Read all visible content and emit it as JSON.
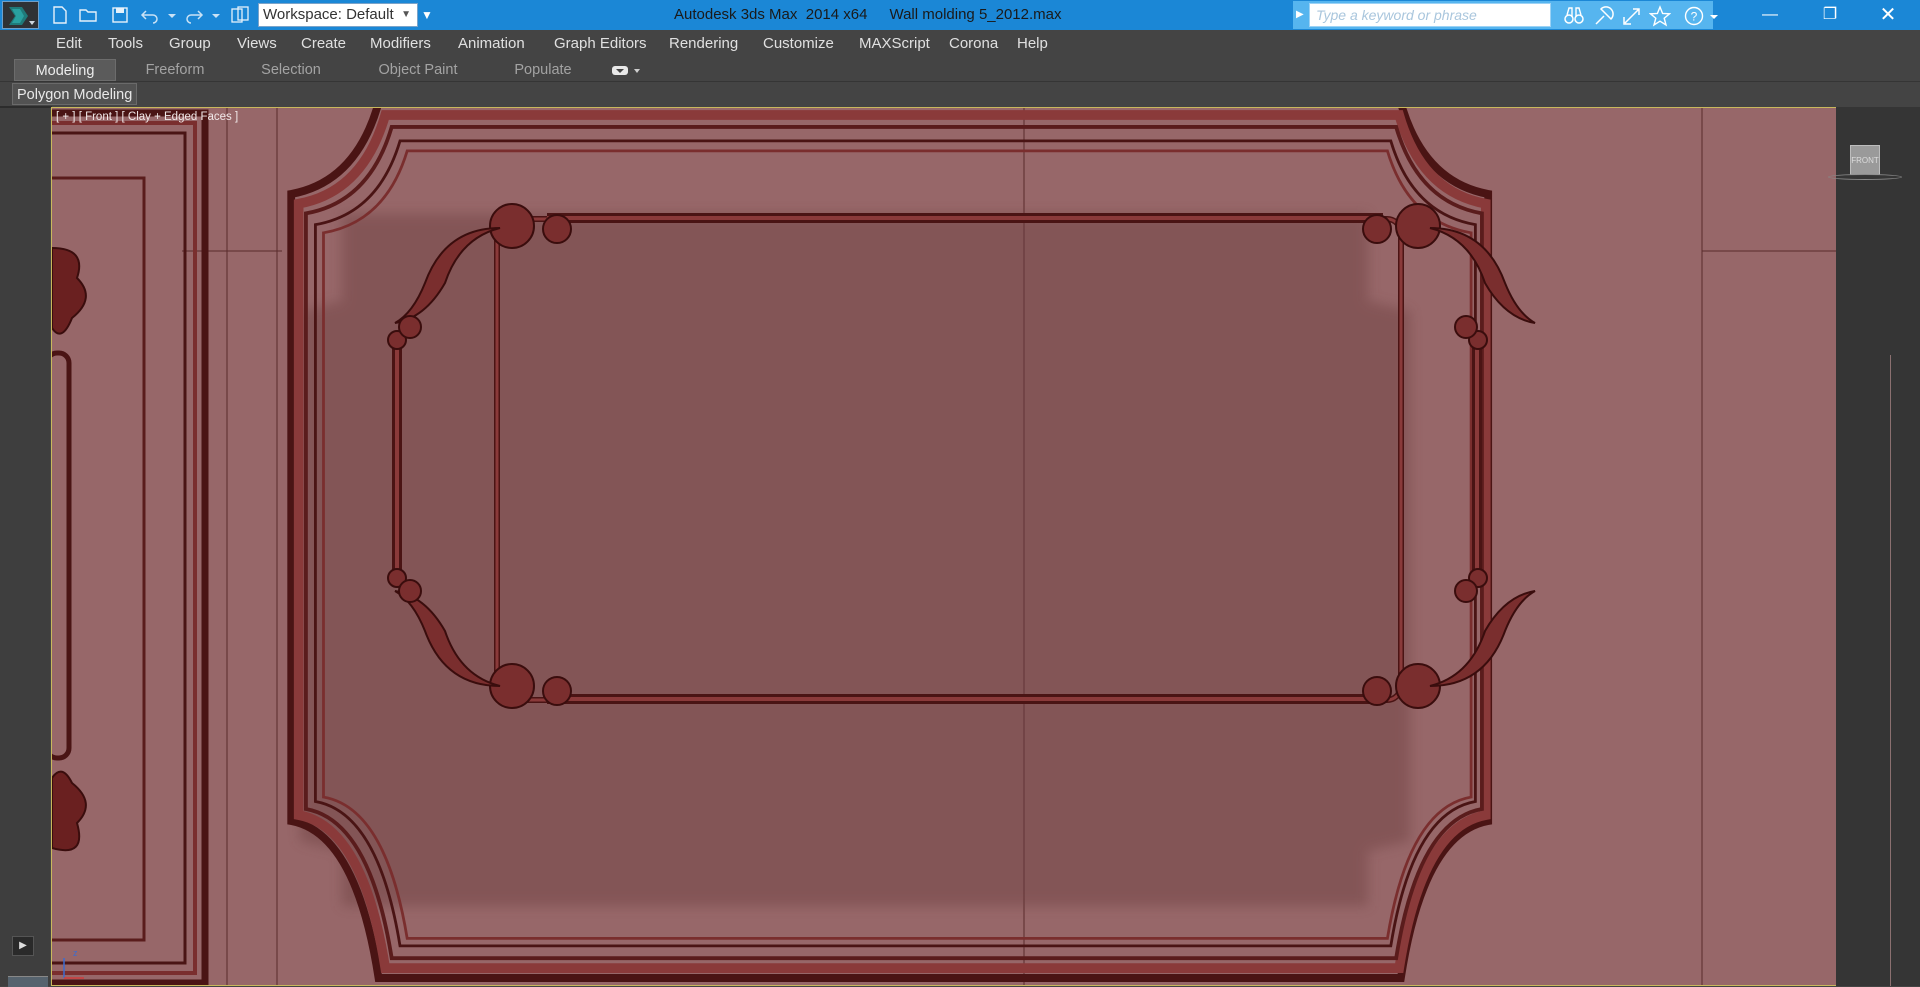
{
  "app": {
    "title": "Autodesk 3ds Max  2014 x64",
    "file": "Wall molding 5_2012.max"
  },
  "toolbar": {
    "workspace_value": "Workspace: Default",
    "search_placeholder": "Type a keyword or phrase",
    "icons": [
      "app-menu-icon",
      "new-file-icon",
      "open-file-icon",
      "save-icon",
      "undo-icon",
      "redo-icon",
      "project-folder-icon",
      "binoculars-icon",
      "communication-center-icon",
      "exchange-icon",
      "favorites-star-icon",
      "help-icon"
    ]
  },
  "menu": {
    "items": [
      "Edit",
      "Tools",
      "Group",
      "Views",
      "Create",
      "Modifiers",
      "Animation",
      "Graph Editors",
      "Rendering",
      "Customize",
      "MAXScript",
      "Corona",
      "Help"
    ]
  },
  "ribbon": {
    "tabs": [
      "Modeling",
      "Freeform",
      "Selection",
      "Object Paint",
      "Populate"
    ],
    "active": "Modeling",
    "panel_label": "Polygon Modeling"
  },
  "viewport": {
    "label": "[ + ] [ Front ] [ Clay + Edged Faces ]",
    "viewcube_face": "FRONT",
    "axis_label": "z",
    "colors": {
      "background": "#976769",
      "molding": "#7a2e2e",
      "molding_dark": "#4a1414",
      "border_active": "#c9b85d"
    }
  },
  "window": {
    "accent": "#1b87d6"
  }
}
